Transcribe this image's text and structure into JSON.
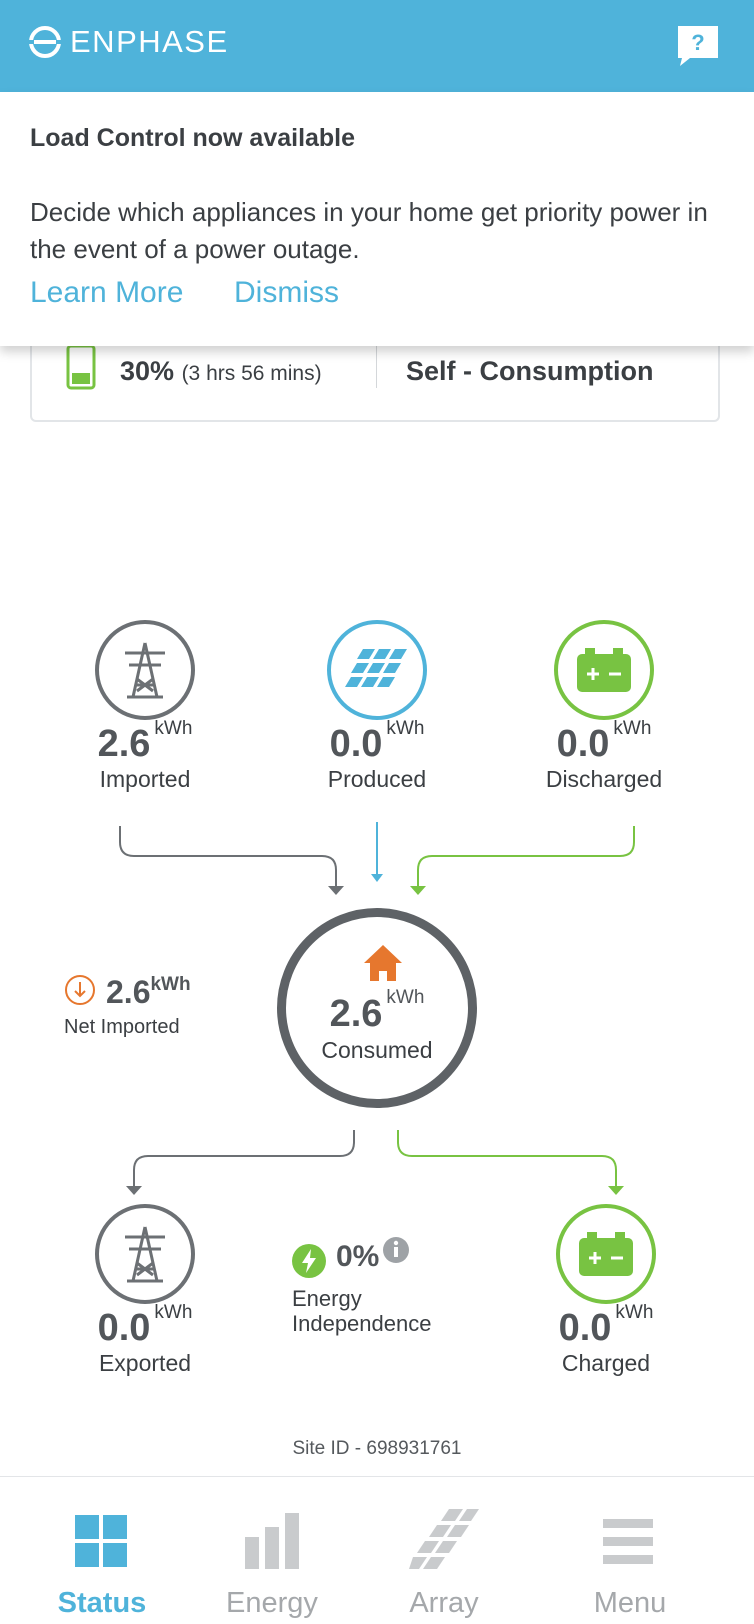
{
  "header": {
    "brand": "ENPHASE",
    "help_icon": "chat-question-icon",
    "colors": {
      "brand_blue": "#4fb3da"
    }
  },
  "banner": {
    "title": "Load Control now available",
    "body": "Decide which appliances in your home get priority power in the event of a power outage.",
    "learn_more": "Learn More",
    "dismiss": "Dismiss"
  },
  "summary_strip": {
    "battery_charge": "30%",
    "battery_time": "(3 hrs 56 mins)",
    "battery_level_fraction": 0.3,
    "profile": "Self - Consumption"
  },
  "flow": {
    "imported": {
      "value": "2.6",
      "unit": "kWh",
      "label": "Imported"
    },
    "produced": {
      "value": "0.0",
      "unit": "kWh",
      "label": "Produced"
    },
    "discharged": {
      "value": "0.0",
      "unit": "kWh",
      "label": "Discharged"
    },
    "consumed": {
      "value": "2.6",
      "unit": "kWh",
      "label": "Consumed"
    },
    "net_imported": {
      "value": "2.6",
      "unit": "kWh",
      "label": "Net Imported"
    },
    "exported": {
      "value": "0.0",
      "unit": "kWh",
      "label": "Exported"
    },
    "energy_independence": {
      "value": "0%",
      "label": "Energy Independence"
    },
    "charged": {
      "value": "0.0",
      "unit": "kWh",
      "label": "Charged"
    },
    "colors": {
      "grid": "#6c7074",
      "solar": "#4fb3da",
      "battery": "#78c342",
      "house": "#e6772e"
    }
  },
  "site_id": "Site ID - 698931761",
  "tabs": [
    {
      "label": "Status",
      "icon": "grid-icon",
      "active": true
    },
    {
      "label": "Energy",
      "icon": "bar-chart-icon",
      "active": false
    },
    {
      "label": "Array",
      "icon": "solar-array-icon",
      "active": false
    },
    {
      "label": "Menu",
      "icon": "hamburger-icon",
      "active": false
    }
  ]
}
